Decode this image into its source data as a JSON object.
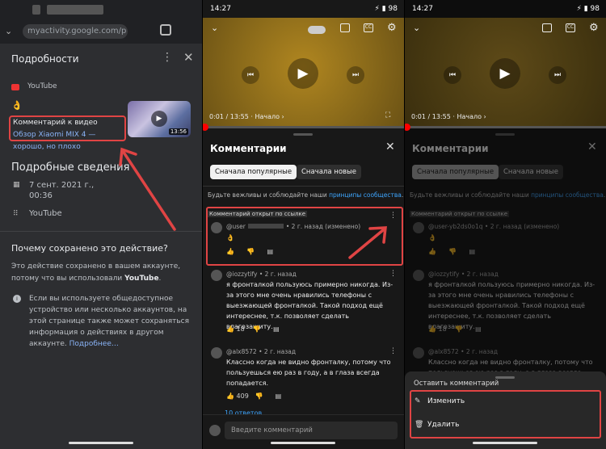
{
  "panel1": {
    "url": "myactivity.google.com/p",
    "sheet_title": "Подробности",
    "source_label": "YouTube",
    "emoji": "👌",
    "comment_prefix": "Комментарий к видео",
    "comment_link": "Обзор Xiaomi MIX 4 — хорошо, но плохо",
    "video_duration": "13:56",
    "details_title": "Подробные сведения",
    "date_text": "7 сент. 2021 г., 00:36",
    "product_text": "YouTube",
    "why_title": "Почему сохранено это действие?",
    "why_text_1": "Это действие сохранено в вашем аккаунте, потому что вы использовали",
    "why_text_bold": "YouTube",
    "why_text_end": ".",
    "note_text": "Если вы используете общедоступное устройство или несколько аккаунтов, на этой странице также может сохраняться информация о действиях в другом аккаунте.",
    "note_link": "Подробнее…"
  },
  "status": {
    "time": "14:27",
    "battery": "98"
  },
  "player": {
    "time": "0:01 / 13:55",
    "chapter": "Начало ›",
    "cc": "CC",
    "progress": 0.01
  },
  "comments": {
    "title": "Комментарии",
    "chip_popular": "Сначала популярные",
    "chip_new": "Сначала новые",
    "rules_prefix": "Будьте вежливы и соблюдайте наши",
    "rules_link": "принципы сообщества",
    "rules_suffix": ".",
    "opened_label": "Комментарий открыт по ссылке",
    "items": [
      {
        "author": "@user",
        "time": "• 2 г. назад (изменено)",
        "text": "👌",
        "likes": ""
      },
      {
        "author": "@iozzytify",
        "time": "• 2 г. назад",
        "text": "я фронталкой пользуюсь примерно никогда. Из-за этого мне очень нравились телефоны с выезжающей фронталкой. Такой подход ещё интереснее, т.к. позволяет сделать влагозащиту.",
        "likes": "18"
      },
      {
        "author": "@alx8572",
        "time": "• 2 г. назад",
        "text": "Классно когда не видно фронталку, потому что пользуешься ею раз в году, а в глаза всегда попадается.",
        "likes": "409"
      }
    ],
    "replies_link": "10 ответов",
    "input_placeholder": "Введите комментарий"
  },
  "panel3": {
    "author_1": "@user-yb2ds0o1q",
    "menu_title": "Оставить комментарий",
    "edit_label": "Изменить",
    "delete_label": "Удалить"
  },
  "colors": {
    "annotation_red": "#e04444",
    "link_blue": "#3ea6ff",
    "yt_red": "#ff0000"
  }
}
